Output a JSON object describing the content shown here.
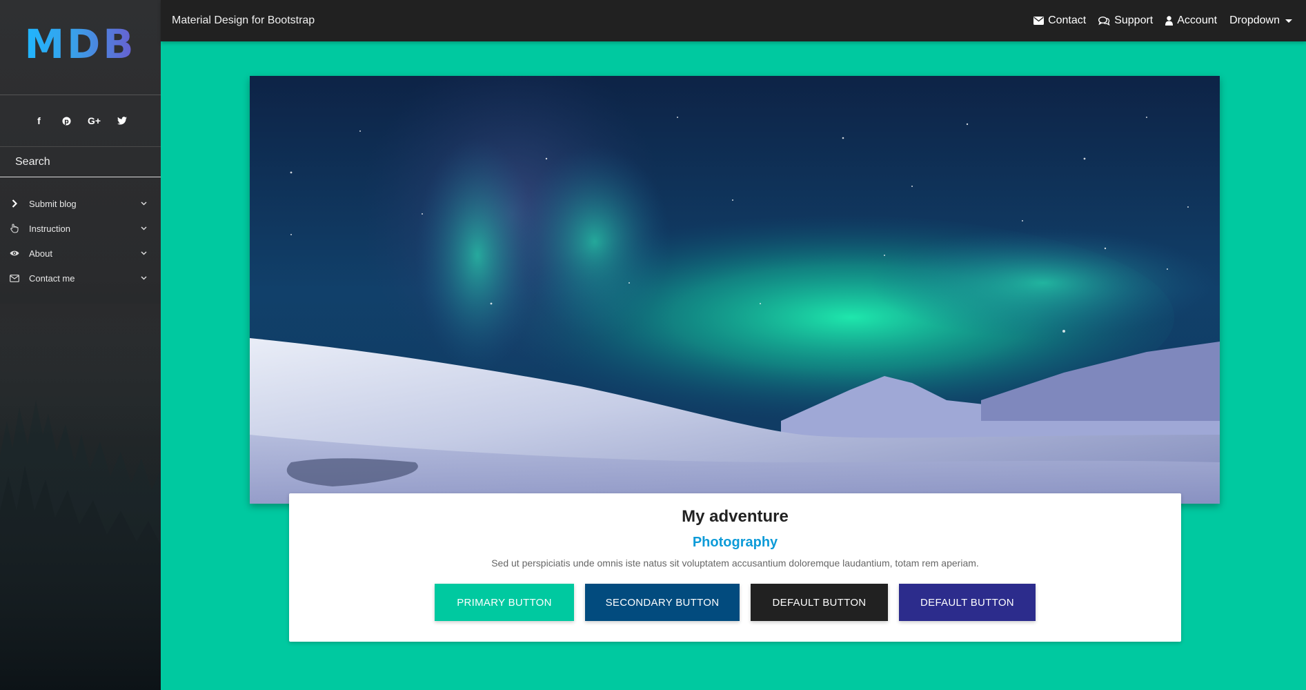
{
  "sidebar": {
    "logo": "MDB",
    "social": [
      {
        "icon": "facebook-icon",
        "glyph": "f"
      },
      {
        "icon": "pinterest-icon",
        "glyph": "p"
      },
      {
        "icon": "google-plus-icon",
        "glyph": "G+"
      },
      {
        "icon": "twitter-icon",
        "glyph": "t"
      }
    ],
    "search": {
      "placeholder": "Search"
    },
    "items": [
      {
        "label": "Submit blog",
        "icon": "chevron-right-icon"
      },
      {
        "label": "Instruction",
        "icon": "hand-pointer-icon"
      },
      {
        "label": "About",
        "icon": "eye-icon"
      },
      {
        "label": "Contact me",
        "icon": "envelope-icon"
      }
    ]
  },
  "navbar": {
    "brand": "Material Design for Bootstrap",
    "links": [
      {
        "label": "Contact",
        "icon": "envelope-icon"
      },
      {
        "label": "Support",
        "icon": "comments-icon"
      },
      {
        "label": "Account",
        "icon": "user-icon"
      },
      {
        "label": "Dropdown",
        "icon": "caret-down-icon"
      }
    ]
  },
  "card": {
    "title": "My adventure",
    "subtitle": "Photography",
    "text": "Sed ut perspiciatis unde omnis iste natus sit voluptatem accusantium doloremque laudantium, totam rem aperiam.",
    "buttons": [
      {
        "label": "Primary button",
        "color": "#00c9a0"
      },
      {
        "label": "Secondary button",
        "color": "#024b7e"
      },
      {
        "label": "Default button",
        "color": "#212121"
      },
      {
        "label": "Default button",
        "color": "#2c2c8c"
      }
    ]
  },
  "colors": {
    "page_background": "#00c9a0",
    "navbar": "#212121",
    "subtitle": "#0d9bd8"
  }
}
